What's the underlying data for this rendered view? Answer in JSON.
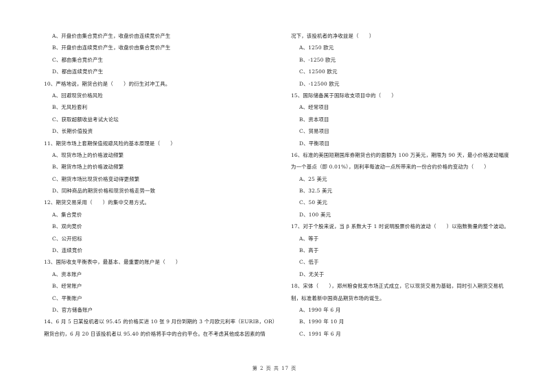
{
  "left_column": [
    {
      "type": "opt",
      "text": "A、开盘价由集合竞价产生，收盘价由连续竞价产生"
    },
    {
      "type": "opt",
      "text": "B、开盘价由连续竞价产生，收盘价由集合竞价产生"
    },
    {
      "type": "opt",
      "text": "C、都由集合竞价产生"
    },
    {
      "type": "opt",
      "text": "D、都由连续竞价产生"
    },
    {
      "type": "q",
      "text": "10、严格地说，期货合约是（　　）的衍生对冲工具。"
    },
    {
      "type": "opt",
      "text": "A、回避现货价格风险"
    },
    {
      "type": "opt",
      "text": "B、无风险套利"
    },
    {
      "type": "opt",
      "text": "C、获取超额收益考试大论坛"
    },
    {
      "type": "opt",
      "text": "D、长期价值投资"
    },
    {
      "type": "q",
      "text": "11、期货市场上套期保值规避风险的基本原理是（　　）"
    },
    {
      "type": "opt",
      "text": "A、现货市场上的价格波动频繁"
    },
    {
      "type": "opt",
      "text": "B、期货市场上的价格波动频繁"
    },
    {
      "type": "opt",
      "text": "C、期货市场比现货价格变动得更频繁"
    },
    {
      "type": "opt",
      "text": "D、同种商品的期货价格和现货价格走势一致"
    },
    {
      "type": "q",
      "text": "12、期货交易采用（　　）的集中交易方式。"
    },
    {
      "type": "opt",
      "text": "A、集合竞价"
    },
    {
      "type": "opt",
      "text": "B、双向竞价"
    },
    {
      "type": "opt",
      "text": "C、公开招标"
    },
    {
      "type": "opt",
      "text": "D、连续竞价"
    },
    {
      "type": "q",
      "text": "13、国际收支平衡表中，最基本、最重要的账户是（　　）"
    },
    {
      "type": "opt",
      "text": "A、资本账户"
    },
    {
      "type": "opt",
      "text": "B、经常账户"
    },
    {
      "type": "opt",
      "text": "C、平衡账户"
    },
    {
      "type": "opt",
      "text": "D、官方储备账户"
    },
    {
      "type": "q",
      "text": "14、6 月 5 日某投机者以 95.45 的价格买进 10 张 9 月份到期的 3 个月欧元利率（EURIB，OR）"
    },
    {
      "type": "cont",
      "text": "期货合约，6 月 20 日该投机者以 95.40 的价格将手中的合约平仓。在不考虑其他成本因素的情"
    }
  ],
  "right_column": [
    {
      "type": "cont",
      "text": "况下，该投机者的净收益是（　　）"
    },
    {
      "type": "opt",
      "text": "A、1250 欧元"
    },
    {
      "type": "opt",
      "text": "B、-1250 欧元"
    },
    {
      "type": "opt",
      "text": "C、12500 欧元"
    },
    {
      "type": "opt",
      "text": "D、-12500 欧元"
    },
    {
      "type": "q",
      "text": "15、国际储备属于国际收支项目中的（　　）"
    },
    {
      "type": "opt",
      "text": "A、经常项目"
    },
    {
      "type": "opt",
      "text": "B、资本项目"
    },
    {
      "type": "opt",
      "text": "C、贸易项目"
    },
    {
      "type": "opt",
      "text": "D、平衡项目"
    },
    {
      "type": "q",
      "text": "16、标准的美国短期国库券期货合约的面额为 100 万美元，期限为 90 天，最小价格波动幅度"
    },
    {
      "type": "cont",
      "text": "为一个基点（即 0.01%），则利率每波动一点所带来的一份合约价格的变动为（　　）"
    },
    {
      "type": "opt",
      "text": "A、25 美元"
    },
    {
      "type": "opt",
      "text": "B、32.5 美元"
    },
    {
      "type": "opt",
      "text": "C、50 美元"
    },
    {
      "type": "opt",
      "text": "D、100 美元"
    },
    {
      "type": "q",
      "text": "17、对于个股来说，当 β 系数大于 1 时说明股票价格的波动（　　）以指数衡量的整个波动。"
    },
    {
      "type": "opt",
      "text": "A、等于"
    },
    {
      "type": "opt",
      "text": "B、高于"
    },
    {
      "type": "opt",
      "text": "C、低于"
    },
    {
      "type": "opt",
      "text": "D、无关于"
    },
    {
      "type": "q",
      "text": "18、宋体（　　），郑州粮食批发市场正式成立，它以现货交易为基础，同时引入期货交易机"
    },
    {
      "type": "cont",
      "text": "制，标准着新中国商品期货市场的诞生。"
    },
    {
      "type": "opt",
      "text": "A、1990 年 6 月"
    },
    {
      "type": "opt",
      "text": "B、1990 年 10 月"
    },
    {
      "type": "opt",
      "text": "C、1991 年 6 月"
    }
  ],
  "footer": {
    "page_label": "第 2 页 共 17 页"
  }
}
